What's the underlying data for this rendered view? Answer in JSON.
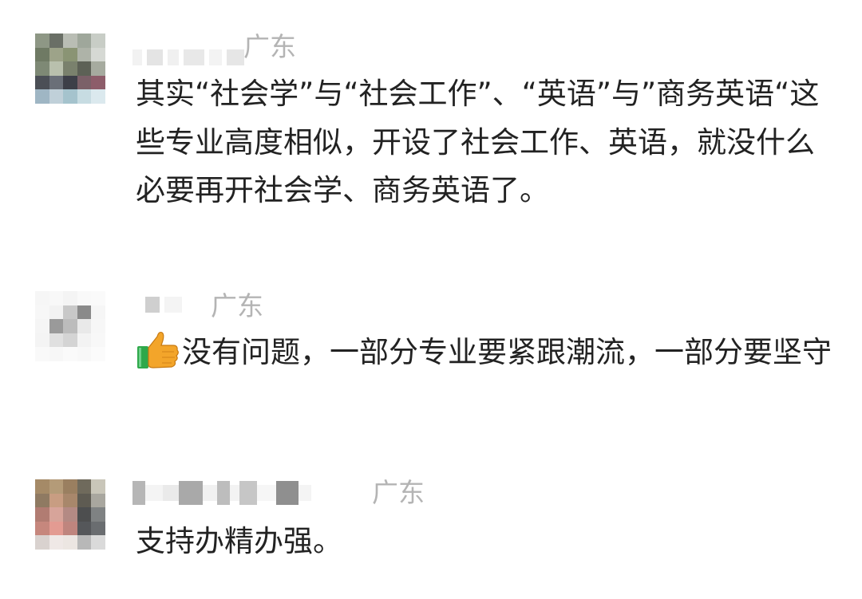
{
  "comments": [
    {
      "location": "广东",
      "text": "其实“社会学”与“社会工作”、“英语”与”商务英语“这些专业高度相似，开设了社会工作、英语，就没什么必要再开社会学、商务英语了。"
    },
    {
      "location": "广东",
      "emoji": "thumbs-up-icon",
      "text": "没有问题，一部分专业要紧跟潮流，一部分要坚守"
    },
    {
      "location": "广东",
      "text": "支持办精办强。"
    }
  ],
  "colors": {
    "text": "#222222",
    "location": "#b4b4b4",
    "background": "#ffffff",
    "thumb": "#f3a52a",
    "cuff": "#2ea84a"
  }
}
